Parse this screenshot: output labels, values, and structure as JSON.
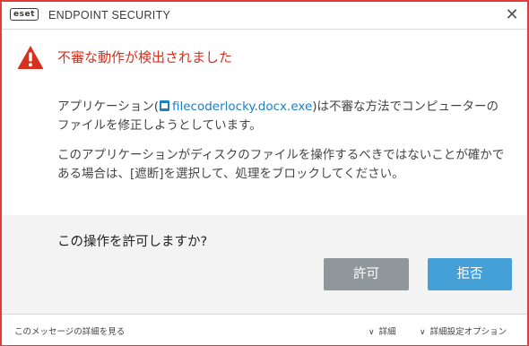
{
  "window": {
    "brand_logo": "eset",
    "product_name": "ENDPOINT SECURITY",
    "close_glyph": "✕"
  },
  "alert": {
    "title": "不審な動作が検出されました",
    "icon": "warning-triangle-icon",
    "color": "#d8301f"
  },
  "message": {
    "line1_prefix": "アプリケーション(",
    "app_name": "filecoderlocky.docx.exe",
    "line1_suffix": ")は不審な方法でコンピューターのファイルを修正しようとしています。",
    "line2": "このアプリケーションがディスクのファイルを操作するべきではないことが確かである場合は、[遮断]を選択して、処理をブロックしてください。"
  },
  "prompt": {
    "question": "この操作を許可しますか?",
    "allow_label": "許可",
    "deny_label": "拒否"
  },
  "footer": {
    "learn_more": "このメッセージの詳細を見る",
    "details_label": "詳細",
    "advanced_label": "詳細設定オプション"
  },
  "colors": {
    "border": "#e43c3c",
    "allow_button": "#8f979a",
    "deny_button": "#45a0d8",
    "link": "#1e7fc2"
  }
}
